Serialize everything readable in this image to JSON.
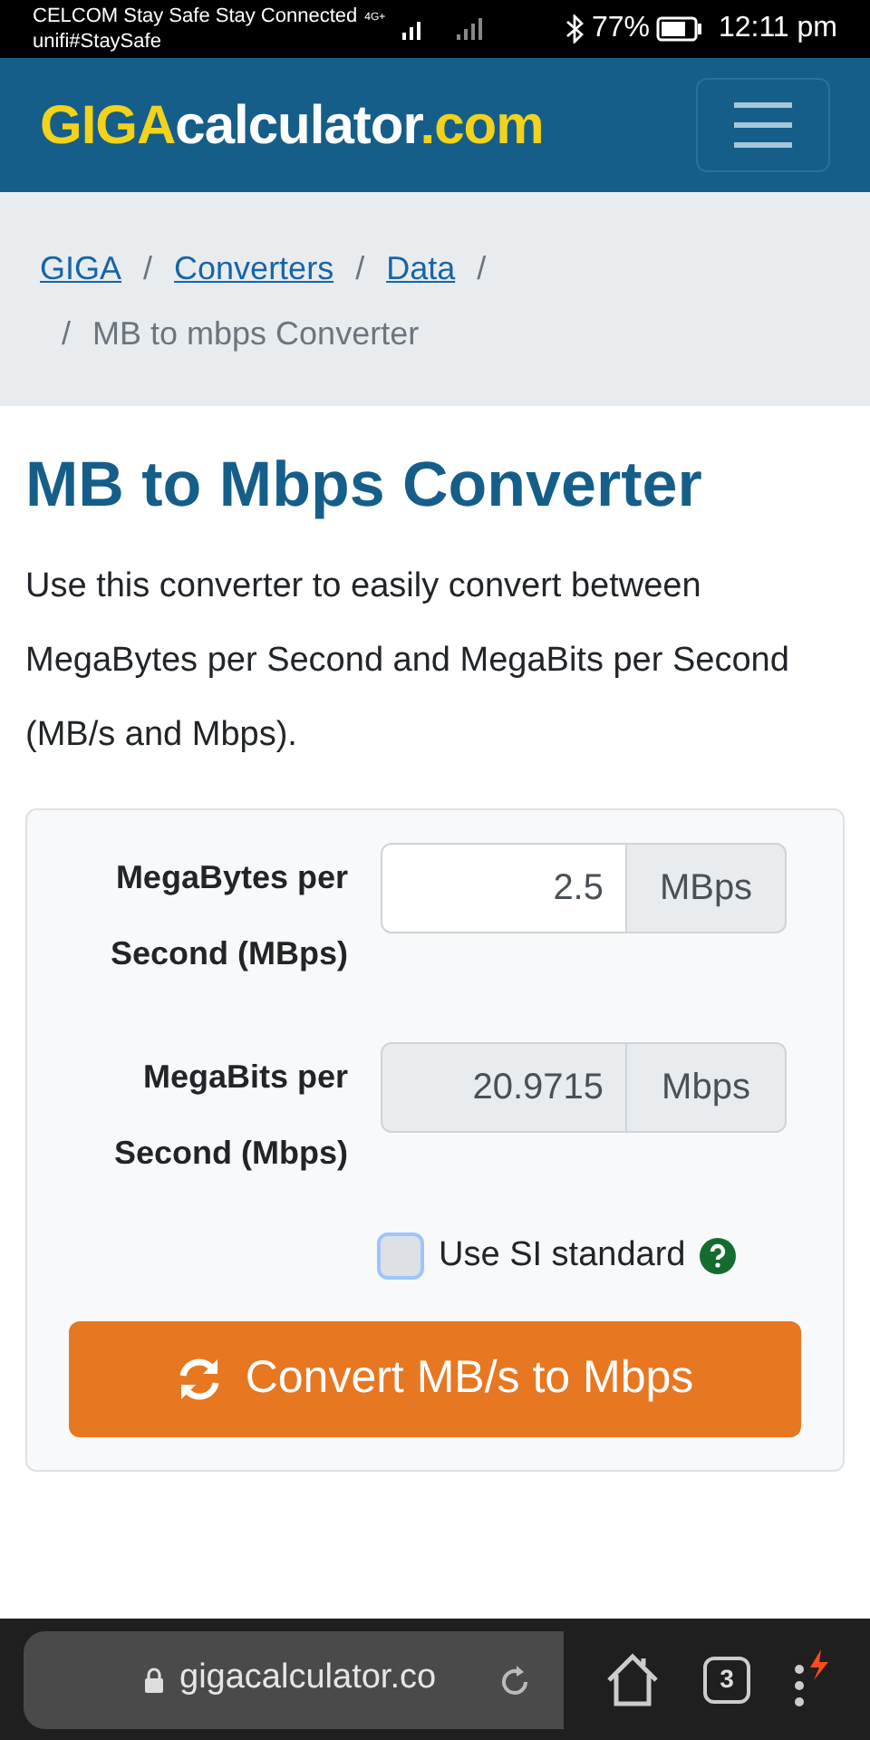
{
  "status_bar": {
    "carrier": "CELCOM Stay Safe Stay Connected",
    "network": "unifi#StaySafe",
    "network_type": "4G+",
    "battery": "77%",
    "time": "12:11 pm"
  },
  "header": {
    "logo": [
      {
        "text": "GIGA",
        "color": "#f2d21b"
      },
      {
        "text": "calculator",
        "color": "#ffffff"
      },
      {
        "text": ".com",
        "color": "#f2d21b"
      }
    ]
  },
  "breadcrumb": {
    "links": [
      "GIGA",
      "Converters",
      "Data"
    ],
    "separator": "/",
    "current": "MB to mbps Converter"
  },
  "title": "MB to Mbps Converter",
  "intro": "Use this converter to easily convert between MegaBytes per Second and MegaBits per Second (MB/s and Mbps).",
  "form": {
    "fields": [
      {
        "label": "MegaBytes per Second (MBps)",
        "value": "2.5",
        "unit": "MBps",
        "readonly": false
      },
      {
        "label": "MegaBits per Second (Mbps)",
        "value": "20.9715",
        "unit": "Mbps",
        "readonly": true
      }
    ],
    "si_checkbox": {
      "label": "Use SI standard",
      "checked": false
    },
    "button": "Convert MB/s to Mbps"
  },
  "browser_bar": {
    "url": "gigacalculator.co",
    "tab_count": "3"
  }
}
